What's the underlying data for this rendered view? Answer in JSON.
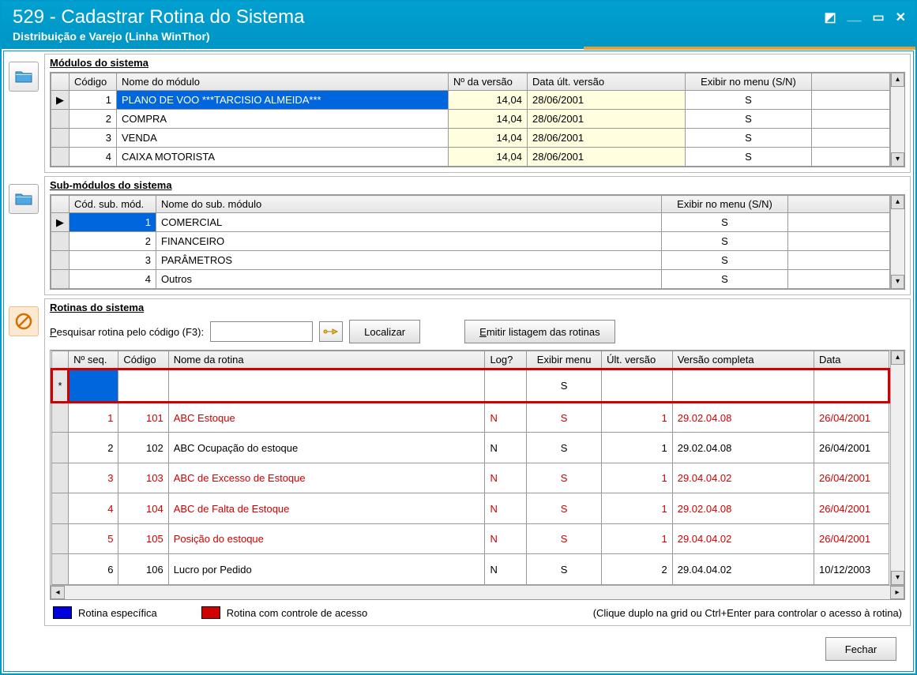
{
  "window": {
    "title": "529 - Cadastrar Rotina do Sistema",
    "subtitle": "Distribuição e Varejo (Linha WinThor)"
  },
  "modules": {
    "title": "Módulos do sistema",
    "headers": {
      "codigo": "Código",
      "nome": "Nome do módulo",
      "versao": "Nº da versão",
      "data": "Data últ. versão",
      "exibir": "Exibir no menu (S/N)"
    },
    "rows": [
      {
        "codigo": "1",
        "nome": "PLANO DE VOO    ***TARCISIO ALMEIDA***",
        "versao": "14,04",
        "data": "28/06/2001",
        "exibir": "S",
        "selected": true
      },
      {
        "codigo": "2",
        "nome": "COMPRA",
        "versao": "14,04",
        "data": "28/06/2001",
        "exibir": "S"
      },
      {
        "codigo": "3",
        "nome": "VENDA",
        "versao": "14,04",
        "data": "28/06/2001",
        "exibir": "S"
      },
      {
        "codigo": "4",
        "nome": "CAIXA MOTORISTA",
        "versao": "14,04",
        "data": "28/06/2001",
        "exibir": "S"
      }
    ]
  },
  "submodules": {
    "title": "Sub-módulos do sistema",
    "headers": {
      "cod": "Cód. sub. mód.",
      "nome": "Nome do sub. módulo",
      "exibir": "Exibir no menu (S/N)"
    },
    "rows": [
      {
        "cod": "1",
        "nome": "COMERCIAL",
        "exibir": "S",
        "selected": true
      },
      {
        "cod": "2",
        "nome": "FINANCEIRO",
        "exibir": "S"
      },
      {
        "cod": "3",
        "nome": "PARÂMETROS",
        "exibir": "S"
      },
      {
        "cod": "4",
        "nome": "Outros",
        "exibir": "S"
      }
    ]
  },
  "rotinas": {
    "title": "Rotinas do sistema",
    "search_label": "Pesquisar rotina pelo código (F3):",
    "localizar": "Localizar",
    "emitir": "Emitir listagem das rotinas",
    "headers": {
      "seq": "Nº seq.",
      "codigo": "Código",
      "nome": "Nome da rotina",
      "log": "Log?",
      "exibir": "Exibir menu",
      "ult": "Últ. versão",
      "completa": "Versão completa",
      "data": "Data"
    },
    "new_row_exibir": "S",
    "rows": [
      {
        "seq": "1",
        "codigo": "101",
        "nome": "ABC Estoque",
        "log": "N",
        "exibir": "S",
        "ult": "1",
        "completa": "29.02.04.08",
        "data": "26/04/2001",
        "red": true
      },
      {
        "seq": "2",
        "codigo": "102",
        "nome": "ABC Ocupação do estoque",
        "log": "N",
        "exibir": "S",
        "ult": "1",
        "completa": "29.02.04.08",
        "data": "26/04/2001",
        "red": false
      },
      {
        "seq": "3",
        "codigo": "103",
        "nome": "ABC de Excesso de Estoque",
        "log": "N",
        "exibir": "S",
        "ult": "1",
        "completa": "29.04.04.02",
        "data": "26/04/2001",
        "red": true
      },
      {
        "seq": "4",
        "codigo": "104",
        "nome": "ABC de Falta de Estoque",
        "log": "N",
        "exibir": "S",
        "ult": "1",
        "completa": "29.02.04.08",
        "data": "26/04/2001",
        "red": true
      },
      {
        "seq": "5",
        "codigo": "105",
        "nome": "Posição do estoque",
        "log": "N",
        "exibir": "S",
        "ult": "1",
        "completa": "29.04.04.02",
        "data": "26/04/2001",
        "red": true
      },
      {
        "seq": "6",
        "codigo": "106",
        "nome": "Lucro por Pedido",
        "log": "N",
        "exibir": "S",
        "ult": "2",
        "completa": "29.04.04.02",
        "data": "10/12/2003",
        "red": false
      }
    ],
    "legend": {
      "especifica": "Rotina específica",
      "controle": "Rotina com controle de acesso",
      "hint": "(Clique duplo na grid ou Ctrl+Enter para controlar o acesso à rotina)"
    }
  },
  "footer": {
    "fechar": "Fechar"
  },
  "colors": {
    "accent": "#0066dd",
    "red": "#d00000",
    "specific_blue": "#0000dd"
  }
}
